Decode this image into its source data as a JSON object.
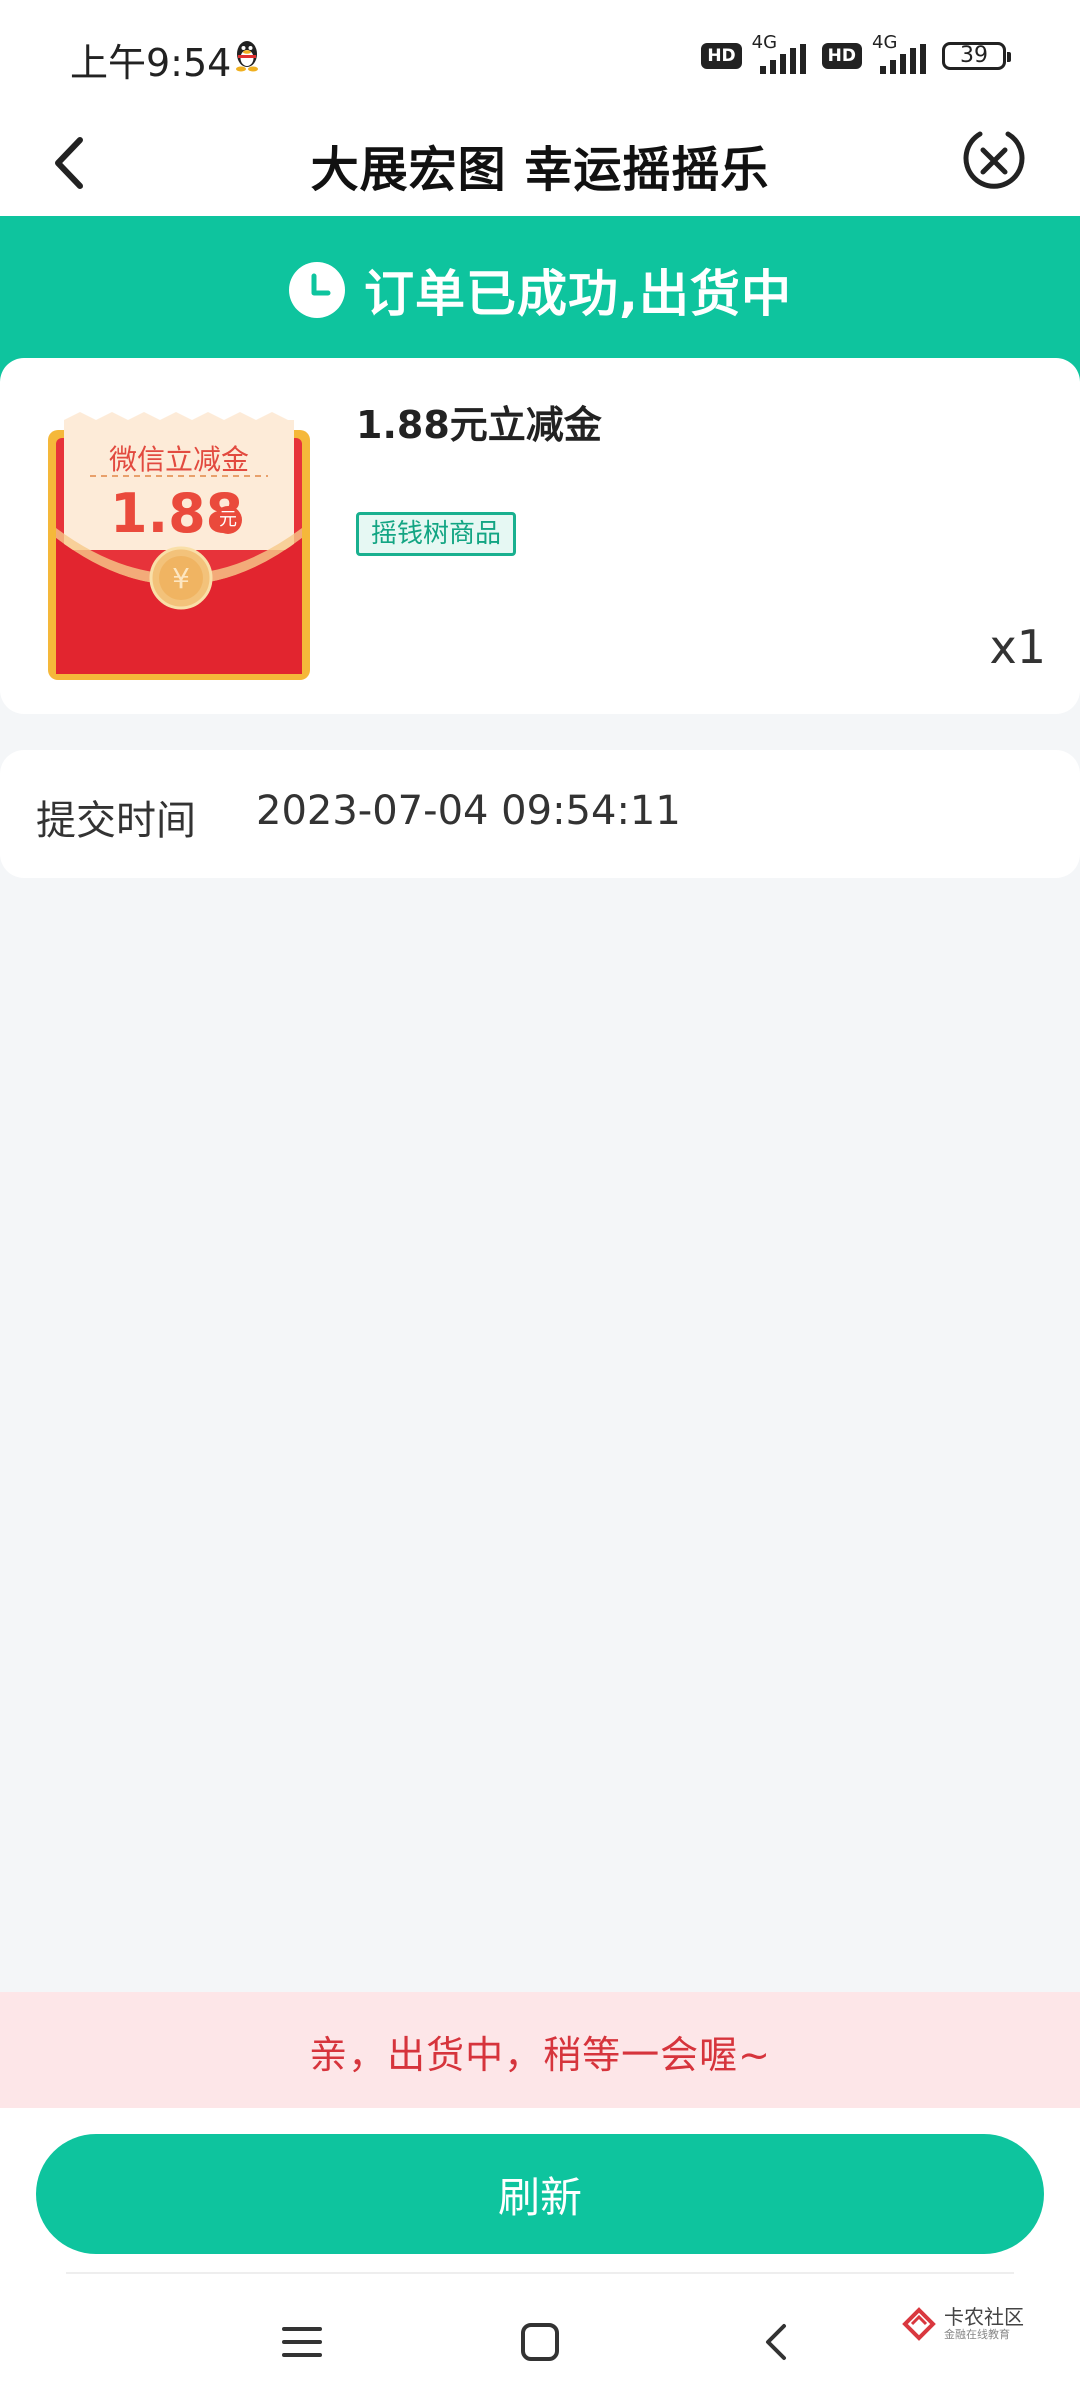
{
  "status_bar": {
    "time": "上午9:54",
    "hd_label": "HD",
    "network": "4G",
    "battery": "39"
  },
  "header": {
    "title": "大展宏图 幸运摇摇乐"
  },
  "banner": {
    "text": "订单已成功,出货中"
  },
  "product": {
    "name": "1.88元立减金",
    "image_label": "微信立减金",
    "image_amount": "1.88",
    "image_unit": "元",
    "tag": "摇钱树商品",
    "quantity": "x1"
  },
  "submit_info": {
    "label": "提交时间",
    "value": "2023-07-04 09:54:11"
  },
  "notice": {
    "text": "亲，出货中，稍等一会喔~"
  },
  "actions": {
    "refresh_label": "刷新"
  },
  "watermark": {
    "title": "卡农社区",
    "subtitle": "金融在线教育"
  },
  "colors": {
    "accent": "#0ec49e",
    "notice_bg": "#fde6e8",
    "notice_text": "#d6343c"
  }
}
